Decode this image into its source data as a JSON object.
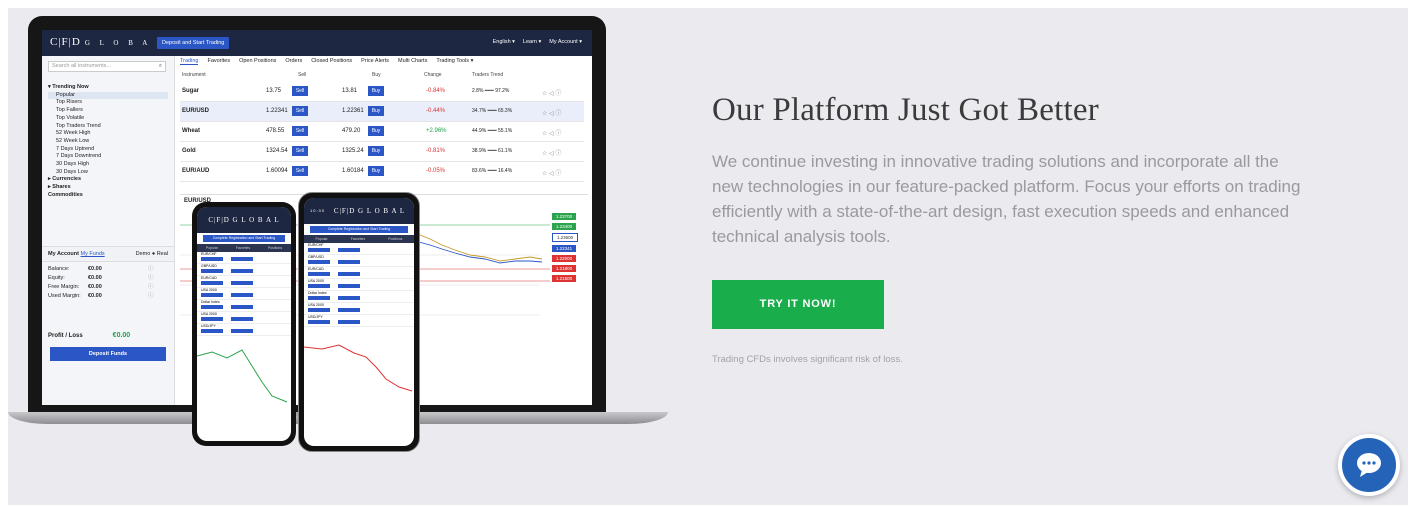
{
  "hero": {
    "title": "Our Platform Just Got Better",
    "description": "We continue investing in innovative trading solutions and incorporate all the new technologies in our feature-packed platform. Focus your efforts on trading efficiently with a state-of-the-art design, fast execution speeds and enhanced technical analysis tools.",
    "cta_label": "TRY IT NOW!",
    "risk_note": "Trading CFDs involves significant risk of loss.",
    "cta_color": "#1aad4c"
  },
  "chat": {
    "icon": "chat-bubble-icon",
    "color": "#2563b9"
  },
  "app": {
    "logo": "C|F|D",
    "logo_sub": "G L O B A L",
    "deposit_top": "Deposit and Start Trading",
    "language": "English ▾",
    "learn": "Learn ▾",
    "my_account": "My Account ▾",
    "search_placeholder": "Search all instruments...",
    "tabs": [
      "Trading",
      "Favorites",
      "Open Positions",
      "Orders",
      "Closed Positions",
      "Price Alerts",
      "Multi Charts",
      "Trading Tools ▾"
    ],
    "columns": [
      "Instrument",
      "Sell",
      "Buy",
      "Change",
      "Traders Trend"
    ],
    "tree": [
      {
        "label": "▾ Trending Now",
        "group": true
      },
      {
        "label": "Popular",
        "hl": true
      },
      {
        "label": "Top Risers"
      },
      {
        "label": "Top Fallers"
      },
      {
        "label": "Top Volatile"
      },
      {
        "label": "Top Traders Trend"
      },
      {
        "label": "52 Week High"
      },
      {
        "label": "52 Week Low"
      },
      {
        "label": "7 Days Uptrend"
      },
      {
        "label": "7 Days Downtrend"
      },
      {
        "label": "30 Days High"
      },
      {
        "label": "30 Days Low"
      },
      {
        "label": "▸ Currencies",
        "group": true
      },
      {
        "label": "▸ Shares",
        "group": true
      },
      {
        "label": "Commodities",
        "group": true
      }
    ],
    "instruments": [
      {
        "name": "Sugar",
        "sell": "13.75",
        "buy": "13.81",
        "change": "-0.84%",
        "trend": "2.8% ━━━ 97.2%"
      },
      {
        "name": "EUR/USD",
        "sell": "1.22341",
        "buy": "1.22361",
        "change": "-0.44%",
        "trend": "34.7% ━━━ 65.3%"
      },
      {
        "name": "Wheat",
        "sell": "478.55",
        "buy": "479.20",
        "change": "+2.96%",
        "trend": "44.9% ━━━ 55.1%"
      },
      {
        "name": "Gold",
        "sell": "1324.54",
        "buy": "1325.24",
        "change": "-0.81%",
        "trend": "38.9% ━━━ 61.1%"
      },
      {
        "name": "EUR/AUD",
        "sell": "1.60094",
        "buy": "1.60184",
        "change": "-0.05%",
        "trend": "83.6% ━━━ 16.4%"
      }
    ],
    "sell_label": "Sell",
    "buy_label": "Buy",
    "account": {
      "title": "My Account",
      "my_funds": "My Funds",
      "demo": "Demo",
      "real": "Real",
      "rows": [
        {
          "label": "Balance:",
          "value": "€0.00"
        },
        {
          "label": "Equity:",
          "value": "€0.00"
        },
        {
          "label": "Free Margin:",
          "value": "€0.00"
        },
        {
          "label": "Used Margin:",
          "value": "€0.00"
        }
      ],
      "profit_label": "Profit / Loss",
      "profit_value": "€0.00",
      "deposit_label": "Deposit Funds"
    },
    "chart_symbol": "EUR/USD",
    "price_tags": [
      "1.23700",
      "1.23400",
      "1.23600",
      "1.22341",
      "1.22000",
      "1.21800",
      "1.21500"
    ]
  },
  "phone": {
    "logo": "C|F|D G L O B A L",
    "cta": "Complete Registration and Start Trading",
    "tabs": [
      "Popular",
      "Favorites",
      "Positions"
    ],
    "time": "10:30",
    "rows": [
      "EUR/CHF",
      "GBP/USD",
      "EUR/CAD",
      "USA 2000",
      "Dollar Index",
      "USA 2000",
      "USD/JPY"
    ]
  }
}
